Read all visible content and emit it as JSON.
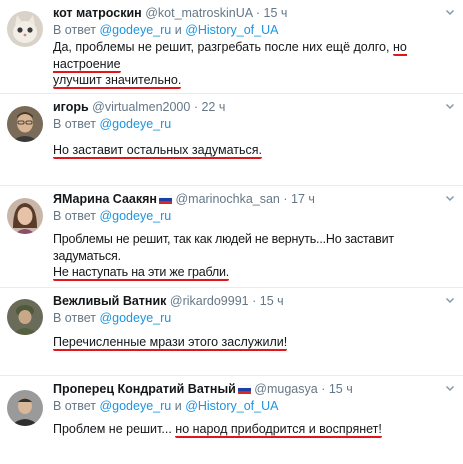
{
  "tweets": [
    {
      "name": "кот матроскин",
      "handle": "@kot_matroskinUA",
      "time": "15 ч",
      "reply_prefix": "В ответ",
      "reply_to_1": "@godeye_ru",
      "reply_and": "и",
      "reply_to_2": "@History_of_UA",
      "text_plain": "Да, проблемы не решит, разгребать после них ещё долго,",
      "text_underlined_1": "но настроение",
      "text_underlined_2": "улучшит значительно."
    },
    {
      "name": "игорь",
      "handle": "@virtualmen2000",
      "time": "22 ч",
      "reply_prefix": "В ответ",
      "reply_to_1": "@godeye_ru",
      "text_underlined": "Но заставит остальных задуматься."
    },
    {
      "name": "ЯМарина Саакян",
      "handle": "@marinochka_san",
      "time": "17 ч",
      "reply_prefix": "В ответ",
      "reply_to_1": "@godeye_ru",
      "text_line_1": "Проблемы не решит, так как людей не вернуть...Но заставит задуматься.",
      "text_underlined": "Не наступать на эти же грабли."
    },
    {
      "name": "Вежливый Ватник",
      "handle": "@rikardo9991",
      "time": "15 ч",
      "reply_prefix": "В ответ",
      "reply_to_1": "@godeye_ru",
      "text_underlined": "Перечисленные мрази этого заслужили!"
    },
    {
      "name": "Проперец Кондратий Ватный",
      "handle": "@mugasya",
      "time": "15 ч",
      "reply_prefix": "В ответ",
      "reply_to_1": "@godeye_ru",
      "reply_and": "и",
      "reply_to_2": "@History_of_UA",
      "text_plain": "Проблем не решит...",
      "text_underlined": "но народ прибодрится и воспрянет!"
    }
  ],
  "separator": "·",
  "colors": {
    "link": "#1b95e0",
    "secondary": "#657786",
    "underline": "#e0161b",
    "divider": "#e6ecf0"
  }
}
